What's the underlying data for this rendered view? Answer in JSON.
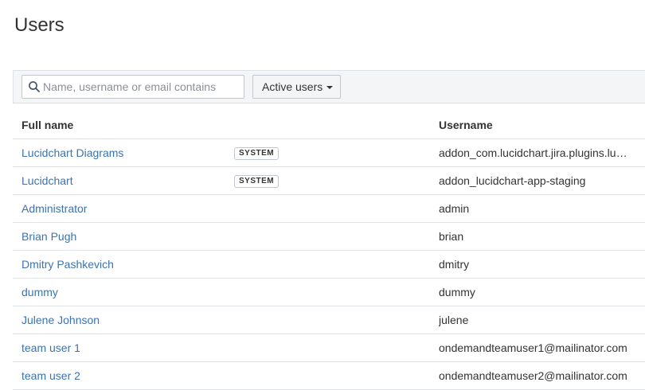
{
  "page": {
    "title": "Users"
  },
  "filter": {
    "search_placeholder": "Name, username or email contains",
    "search_value": "",
    "status_label": "Active users"
  },
  "table": {
    "headers": {
      "full_name": "Full name",
      "username": "Username"
    },
    "rows": [
      {
        "full_name": "Lucidchart Diagrams",
        "badge": "SYSTEM",
        "username": "addon_com.lucidchart.jira.plugins.lu…"
      },
      {
        "full_name": "Lucidchart",
        "badge": "SYSTEM",
        "username": "addon_lucidchart-app-staging"
      },
      {
        "full_name": "Administrator",
        "badge": "",
        "username": "admin"
      },
      {
        "full_name": "Brian Pugh",
        "badge": "",
        "username": "brian"
      },
      {
        "full_name": "Dmitry Pashkevich",
        "badge": "",
        "username": "dmitry"
      },
      {
        "full_name": "dummy",
        "badge": "",
        "username": "dummy"
      },
      {
        "full_name": "Julene Johnson",
        "badge": "",
        "username": "julene"
      },
      {
        "full_name": "team user 1",
        "badge": "",
        "username": "ondemandteamuser1@mailinator.com"
      },
      {
        "full_name": "team user 2",
        "badge": "",
        "username": "ondemandteamuser2@mailinator.com"
      }
    ]
  },
  "colors": {
    "link": "#3b73af",
    "filter_bar_bg": "#f4f5f7",
    "border": "#dfe1e6"
  }
}
